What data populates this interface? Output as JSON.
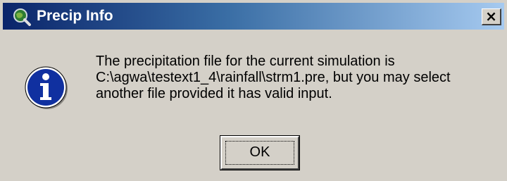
{
  "window": {
    "title": "Precip Info",
    "close_glyph": "×",
    "icon": "globe-magnifier-icon"
  },
  "message": {
    "icon": "info-icon",
    "lines": [
      "The precipitation file for the current simulation is",
      "C:\\agwa\\testext1_4\\rainfall\\strm1.pre, but you may select",
      "another file provided it has valid input."
    ]
  },
  "buttons": {
    "ok_label": "OK"
  },
  "colors": {
    "titlebar_start": "#0a246a",
    "titlebar_end": "#a6caf0",
    "dialog_face": "#d4d0c8",
    "info_icon_blue": "#1030a0"
  }
}
